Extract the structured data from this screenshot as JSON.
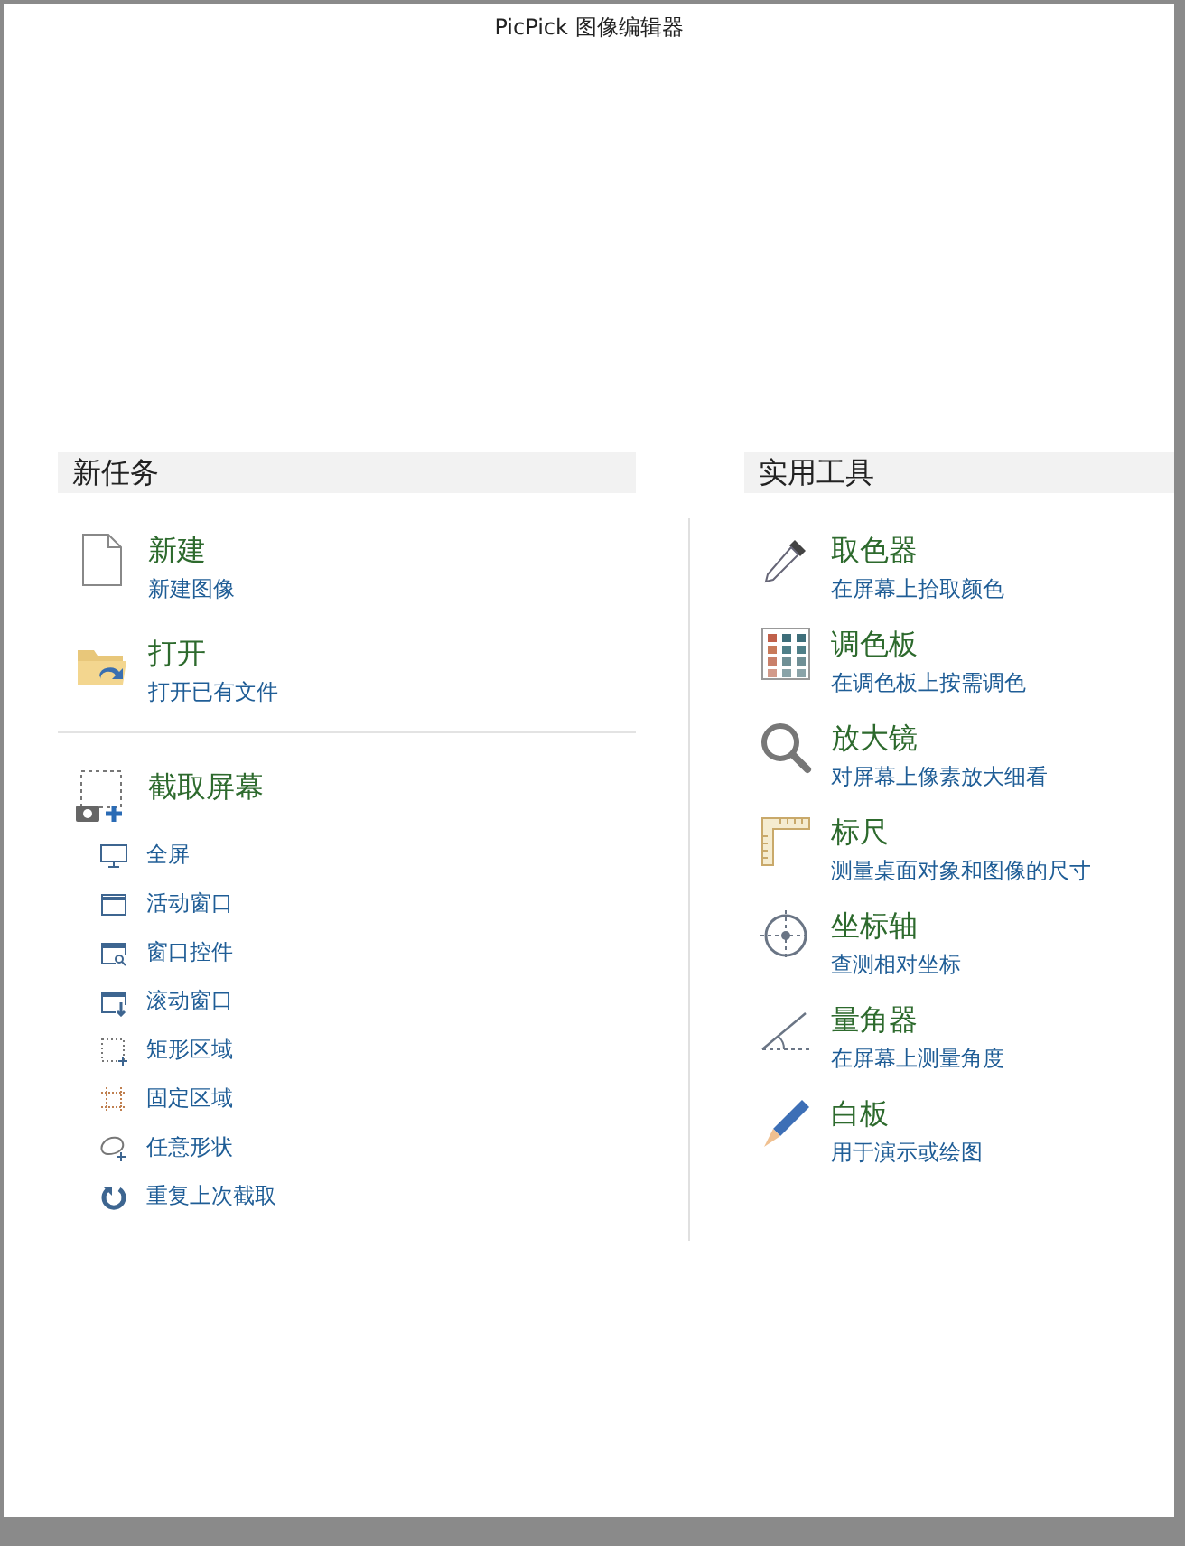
{
  "window": {
    "title": "PicPick 图像编辑器"
  },
  "new_task": {
    "heading": "新任务",
    "items": [
      {
        "title": "新建",
        "subtitle": "新建图像"
      },
      {
        "title": "打开",
        "subtitle": "打开已有文件"
      }
    ],
    "capture": {
      "title": "截取屏幕",
      "options": [
        "全屏",
        "活动窗口",
        "窗口控件",
        "滚动窗口",
        "矩形区域",
        "固定区域",
        "任意形状",
        "重复上次截取"
      ]
    }
  },
  "tools": {
    "heading": "实用工具",
    "items": [
      {
        "title": "取色器",
        "subtitle": "在屏幕上拾取颜色"
      },
      {
        "title": "调色板",
        "subtitle": "在调色板上按需调色"
      },
      {
        "title": "放大镜",
        "subtitle": "对屏幕上像素放大细看"
      },
      {
        "title": "标尺",
        "subtitle": "测量桌面对象和图像的尺寸"
      },
      {
        "title": "坐标轴",
        "subtitle": "查测相对坐标"
      },
      {
        "title": "量角器",
        "subtitle": "在屏幕上测量角度"
      },
      {
        "title": "白板",
        "subtitle": "用于演示或绘图"
      }
    ]
  }
}
